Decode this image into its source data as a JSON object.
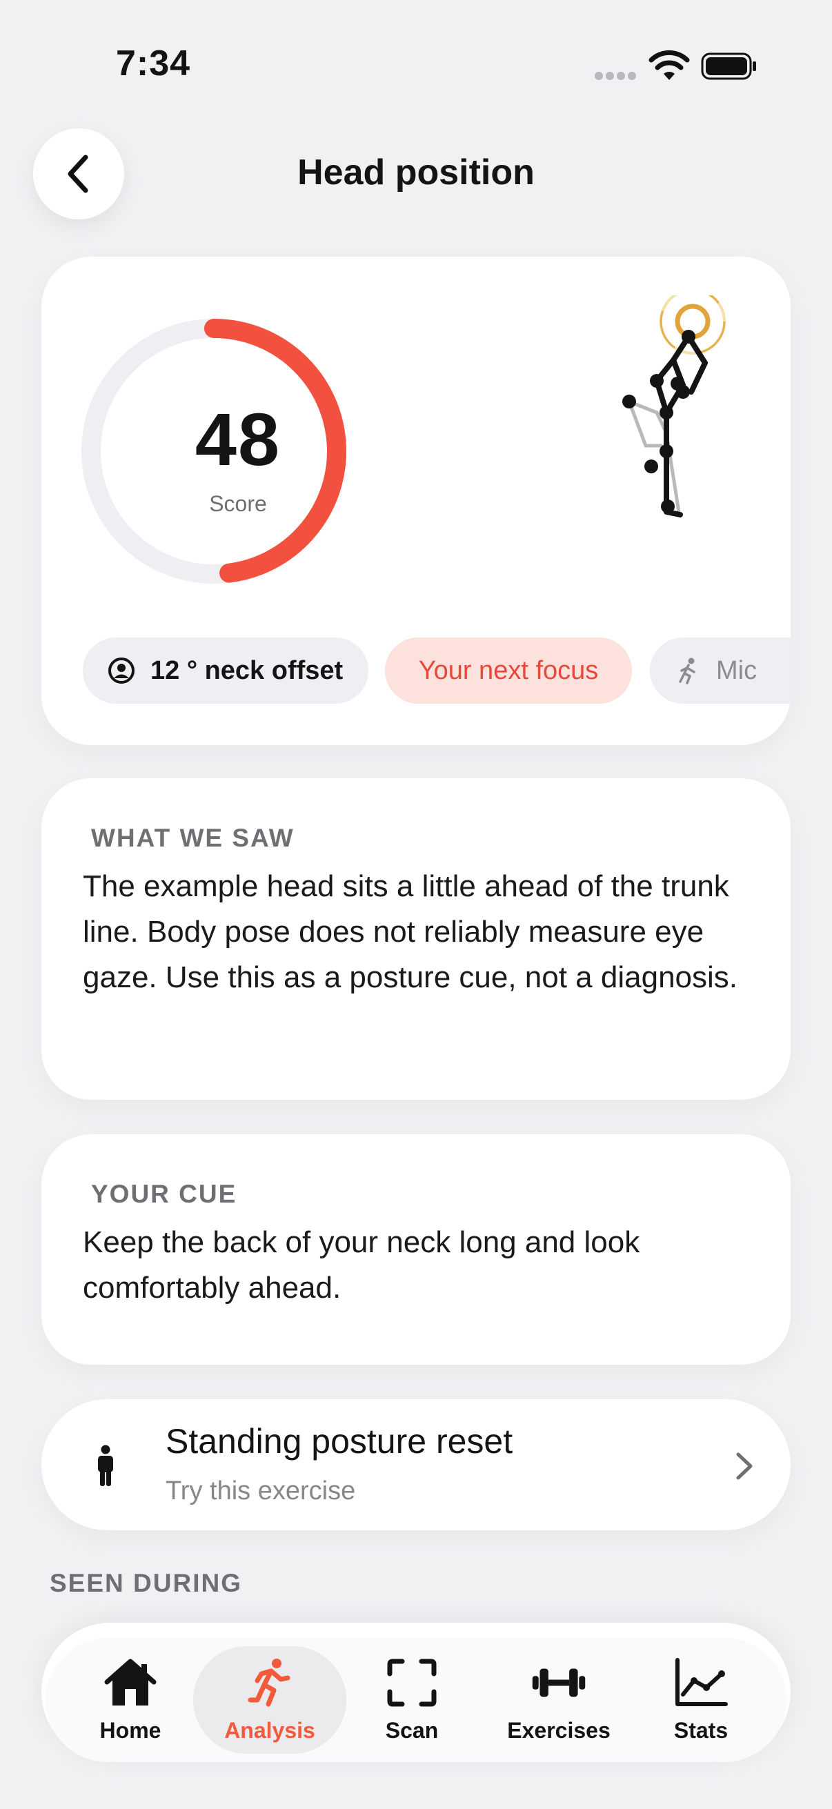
{
  "status_bar": {
    "time": "7:34"
  },
  "header": {
    "title": "Head position",
    "back_icon": "chevron-left-icon"
  },
  "score": {
    "value": "48",
    "label": "Score",
    "ring_fraction": 0.48,
    "ring_color": "#f2513f",
    "track_color": "#efeff3"
  },
  "chips": {
    "neck": {
      "icon": "person-circle-icon",
      "text": "12 ° neck offset"
    },
    "focus": {
      "text": "Your next focus"
    },
    "more": {
      "icon": "walking-icon",
      "text": "Mic"
    }
  },
  "what_we_saw": {
    "label": "WHAT WE SAW",
    "text": "The example head sits a little ahead of the trunk line. Body pose does not reliably measure eye gaze. Use this as a posture cue, not a diagnosis."
  },
  "your_cue": {
    "label": "YOUR CUE",
    "text": "Keep the back of your neck long and look comfortably ahead."
  },
  "exercise": {
    "title": "Standing posture reset",
    "subtitle": "Try this exercise",
    "icon": "standing-person-icon"
  },
  "seen_during": {
    "label": "SEEN DURING"
  },
  "tabs": [
    {
      "label": "Home",
      "icon": "house-icon",
      "active": false
    },
    {
      "label": "Analysis",
      "icon": "running-icon",
      "active": true
    },
    {
      "label": "Scan",
      "icon": "scan-frame-icon",
      "active": false
    },
    {
      "label": "Exercises",
      "icon": "dumbbell-icon",
      "active": false
    },
    {
      "label": "Stats",
      "icon": "line-chart-icon",
      "active": false
    }
  ],
  "colors": {
    "accent": "#f25a3b",
    "focus_chip_bg": "#fde1dd",
    "background": "#f1f1f4",
    "head_marker": "#e0a43a"
  }
}
